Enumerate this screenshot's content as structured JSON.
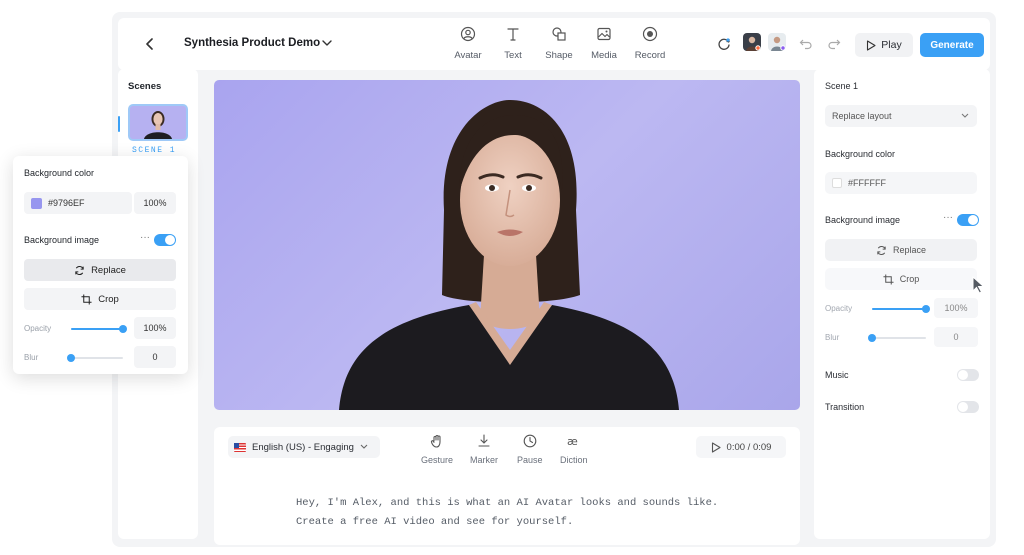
{
  "app": {
    "title": "Synthesia Product Demo",
    "accent_color": "#3aa0f5",
    "canvas_background": "#9796EF"
  },
  "toolbar": {
    "tools": [
      {
        "label": "Avatar",
        "icon": "avatar-icon"
      },
      {
        "label": "Text",
        "icon": "text-icon"
      },
      {
        "label": "Shape",
        "icon": "shape-icon"
      },
      {
        "label": "Media",
        "icon": "media-icon"
      },
      {
        "label": "Record",
        "icon": "record-icon"
      }
    ],
    "play_label": "Play",
    "generate_label": "Generate"
  },
  "scenes": {
    "title": "Scenes",
    "items": [
      {
        "label": "SCENE 1"
      }
    ]
  },
  "script": {
    "language": "English (US) - Engaging",
    "tools": [
      {
        "label": "Gesture",
        "icon": "gesture-icon"
      },
      {
        "label": "Marker",
        "icon": "marker-icon"
      },
      {
        "label": "Pause",
        "icon": "pause-clock-icon"
      },
      {
        "label": "Diction",
        "icon": "diction-icon"
      }
    ],
    "time": "0:00 / 0:09",
    "line1": "Hey, I'm Alex, and this is what an AI Avatar looks and sounds like.",
    "line2": "Create a free AI video and see for yourself."
  },
  "right_panel": {
    "scene_title": "Scene 1",
    "layout_select": "Replace layout",
    "bg_color_label": "Background color",
    "bg_color_value": "#FFFFFF",
    "bg_image_label": "Background image",
    "bg_image_enabled": true,
    "replace_label": "Replace",
    "crop_label": "Crop",
    "opacity_label": "Opacity",
    "opacity_value": "100%",
    "opacity_level": 1.0,
    "blur_label": "Blur",
    "blur_value": "0",
    "blur_level": 0.0,
    "music_label": "Music",
    "music_enabled": false,
    "transition_label": "Transition",
    "transition_enabled": false
  },
  "floating_panel": {
    "bg_color_label": "Background color",
    "bg_color_hex": "#9796EF",
    "bg_color_opacity": "100%",
    "bg_image_label": "Background image",
    "bg_image_enabled": true,
    "replace_label": "Replace",
    "crop_label": "Crop",
    "opacity_label": "Opacity",
    "opacity_value": "100%",
    "opacity_level": 1.0,
    "blur_label": "Blur",
    "blur_value": "0",
    "blur_level": 0.0
  }
}
